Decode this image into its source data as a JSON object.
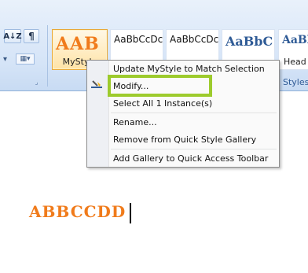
{
  "ribbon": {
    "sort_button": "A↓Z",
    "pilcrow_button": "¶",
    "style_gallery": [
      {
        "sample": "AAB",
        "name": "MyStyle"
      },
      {
        "sample": "AaBbCcDc",
        "name": ""
      },
      {
        "sample": "AaBbCcDc",
        "name": ""
      },
      {
        "sample": "AaBbC",
        "name": ""
      },
      {
        "sample": "AaBb",
        "name": "Head"
      }
    ],
    "group_label_styles": "Styles"
  },
  "context_menu": {
    "items": [
      "Update MyStyle to Match Selection",
      "Modify...",
      "Select All 1 Instance(s)",
      "Rename...",
      "Remove from Quick Style Gallery",
      "Add Gallery to Quick Access Toolbar"
    ]
  },
  "document": {
    "text": "ABBCCDD"
  },
  "colors": {
    "highlight_box": "#9dcb2d",
    "style_orange": "#f07b1b",
    "heading_blue": "#2f5b96"
  }
}
